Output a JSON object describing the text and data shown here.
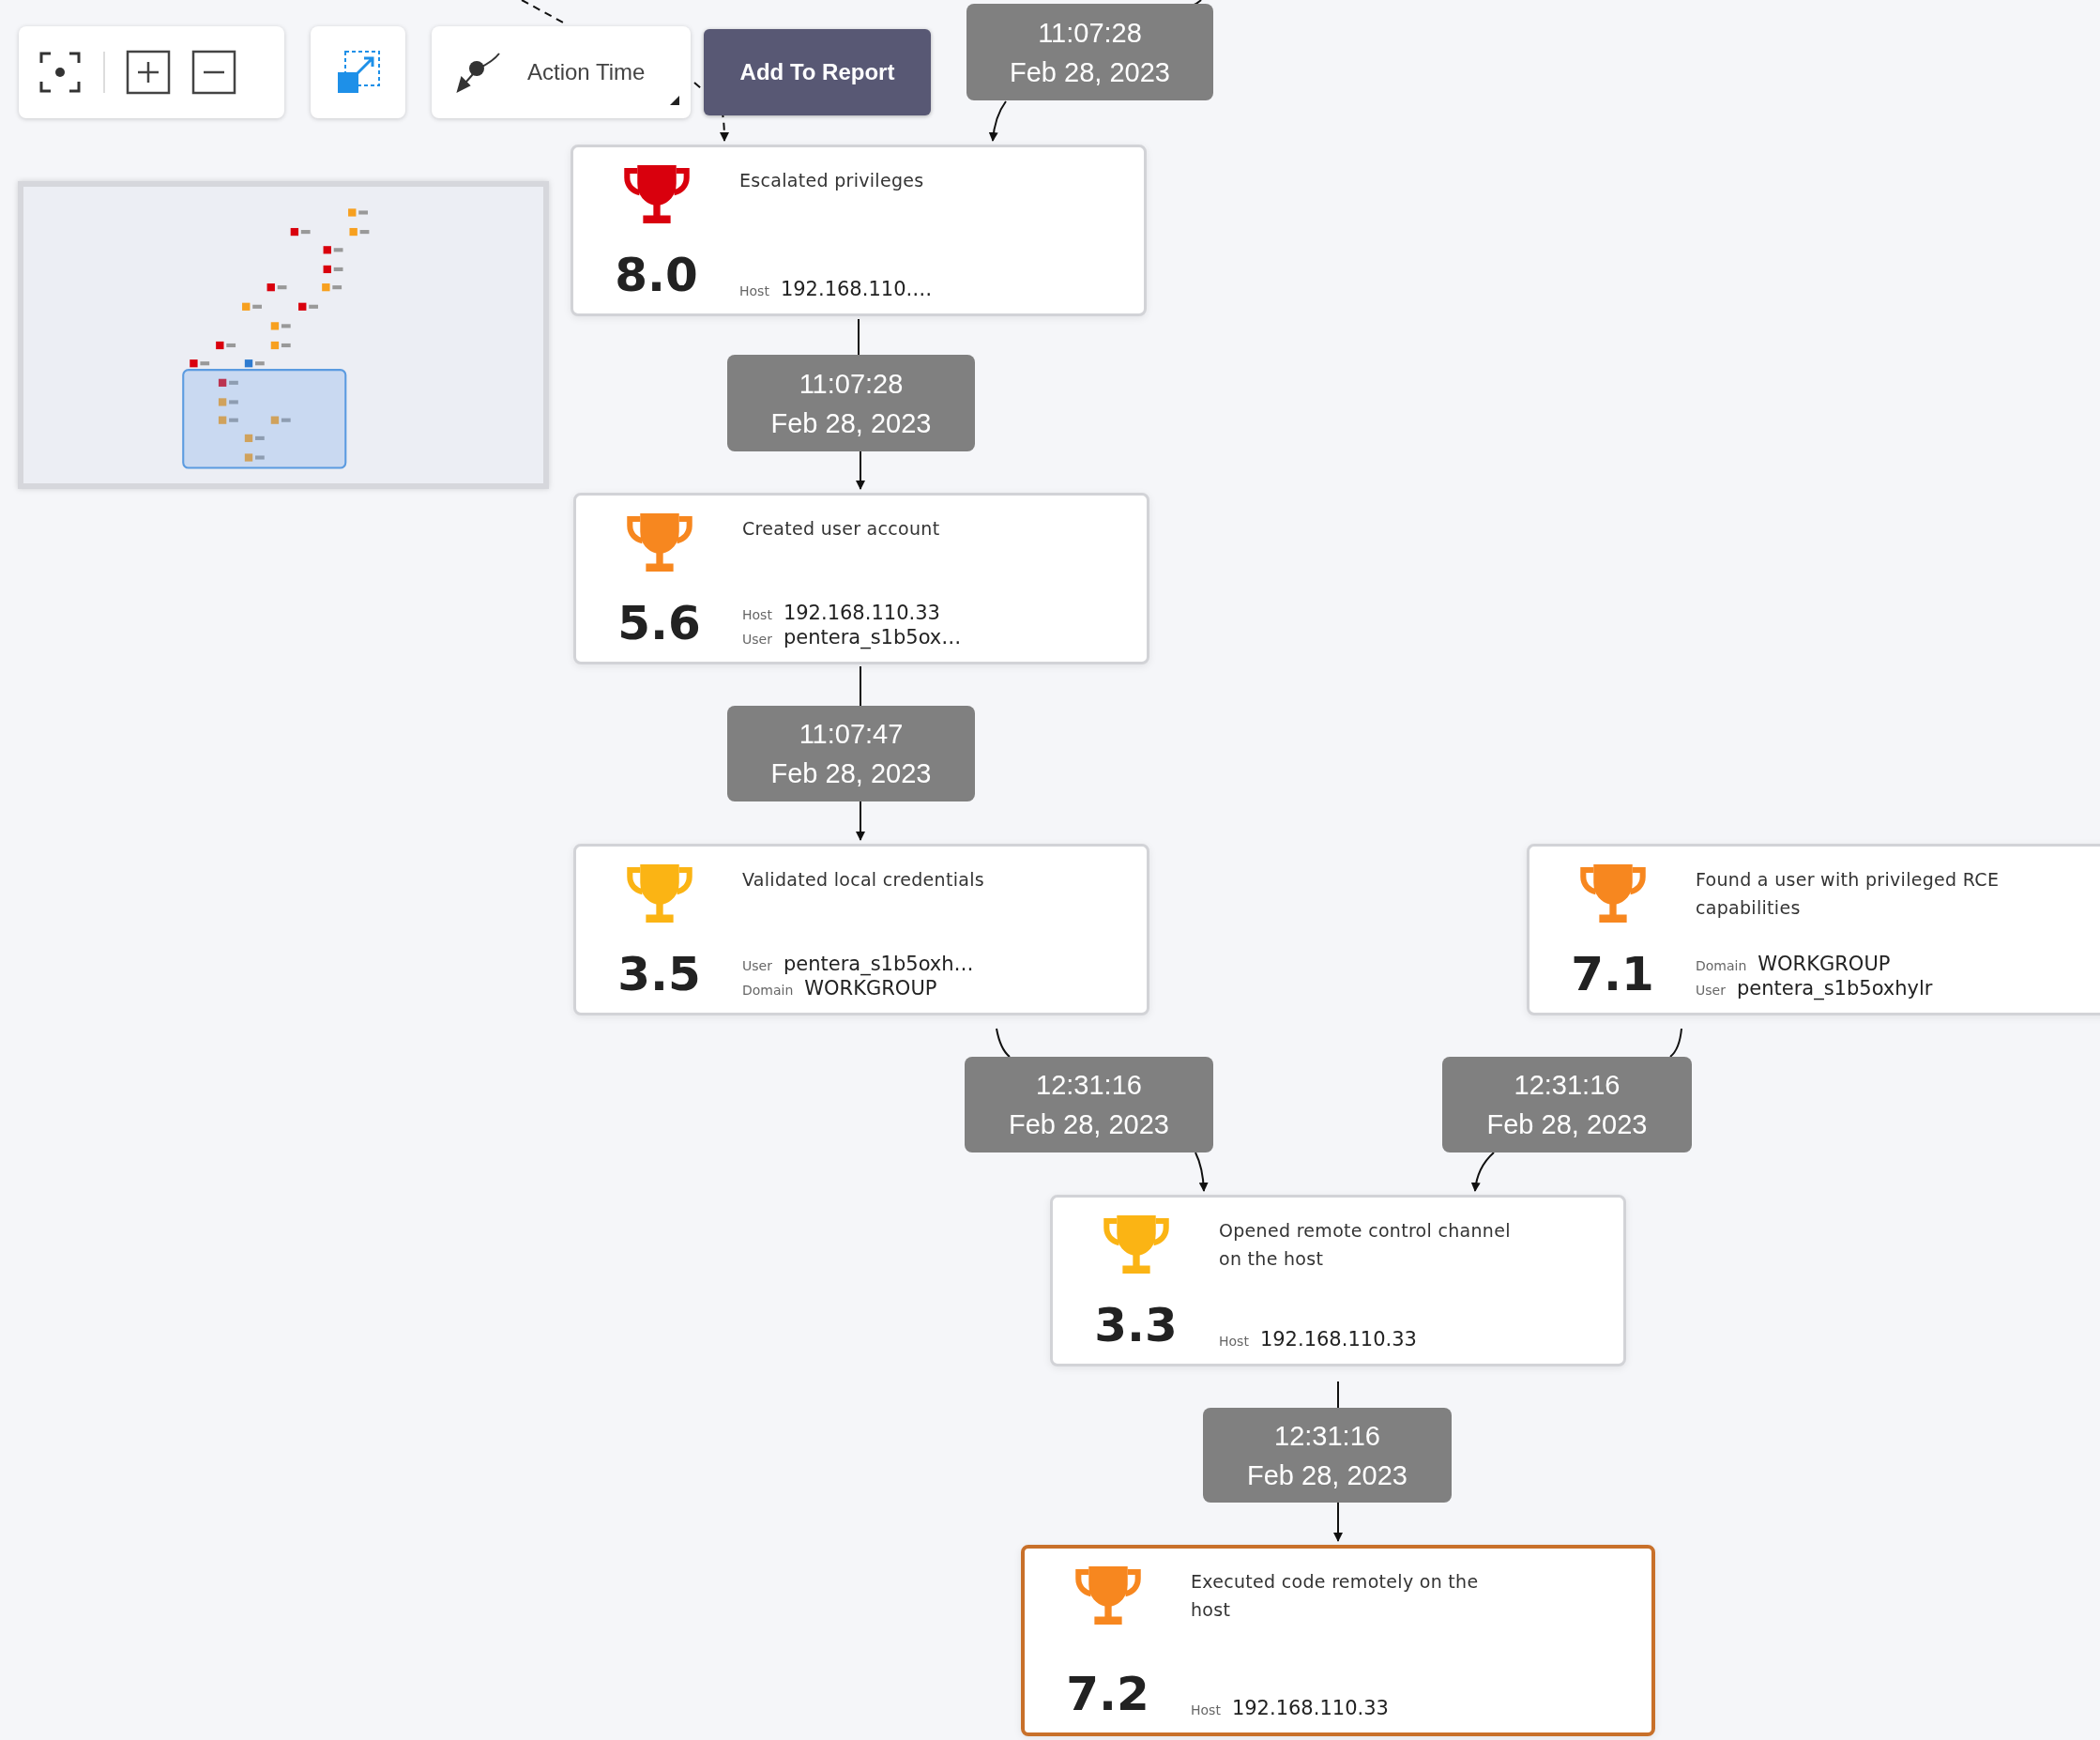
{
  "toolbar": {
    "action_dropdown": {
      "label": "Action Time"
    },
    "add_button": "Add To Report"
  },
  "time_labels": [
    {
      "time": "11:07:28",
      "date": "Feb 28, 2023"
    },
    {
      "time": "11:07:28",
      "date": "Feb 28, 2023"
    },
    {
      "time": "11:07:47",
      "date": "Feb 28, 2023"
    },
    {
      "time": "12:31:16",
      "date": "Feb 28, 2023"
    },
    {
      "time": "12:31:16",
      "date": "Feb 28, 2023"
    },
    {
      "time": "12:31:16",
      "date": "Feb 28, 2023"
    }
  ],
  "nodes": [
    {
      "score": "8.0",
      "title": "Escalated privileges",
      "color": "#d9000d",
      "selected": false,
      "fields": [
        {
          "label": "Host",
          "value": "192.168.110.…"
        }
      ]
    },
    {
      "score": "5.6",
      "title": "Created user account",
      "color": "#f7871f",
      "selected": false,
      "fields": [
        {
          "label": "Host",
          "value": "192.168.110.33"
        },
        {
          "label": "User",
          "value": "pentera_s1b5ox…"
        }
      ]
    },
    {
      "score": "3.5",
      "title": "Validated local credentials",
      "color": "#fbb414",
      "selected": false,
      "fields": [
        {
          "label": "User",
          "value": "pentera_s1b5oxh…"
        },
        {
          "label": "Domain",
          "value": "WORKGROUP"
        }
      ]
    },
    {
      "score": "7.1",
      "title": "Found a user with privileged RCE capabilities",
      "color": "#f7871f",
      "selected": false,
      "fields": [
        {
          "label": "Domain",
          "value": "WORKGROUP"
        },
        {
          "label": "User",
          "value": "pentera_s1b5oxhylr"
        }
      ]
    },
    {
      "score": "3.3",
      "title": "Opened remote control channel on the host",
      "color": "#fbb414",
      "selected": false,
      "fields": [
        {
          "label": "Host",
          "value": "192.168.110.33"
        }
      ]
    },
    {
      "score": "7.2",
      "title": "Executed code remotely on the host",
      "color": "#f7871f",
      "selected": true,
      "fields": [
        {
          "label": "Host",
          "value": "192.168.110.33"
        }
      ]
    }
  ]
}
